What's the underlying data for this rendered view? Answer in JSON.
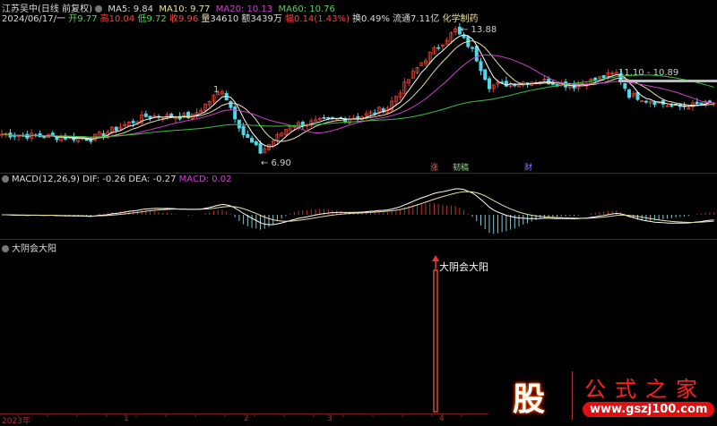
{
  "header": {
    "title": "江苏吴中(日线 前复权)",
    "ma5": "MA5: 9.84",
    "ma10": "MA10: 9.77",
    "ma20": "MA20: 10.13",
    "ma60": "MA60: 10.76",
    "date": "2024/06/17/一",
    "open_l": "开",
    "open": "9.77",
    "high_l": "高",
    "high": "10.04",
    "low_l": "低",
    "low": "9.72",
    "close_l": "收",
    "close": "9.96",
    "vol_l": "量",
    "vol": "34610",
    "amt_l": "额",
    "amt": "3439万",
    "chg_l": "幅",
    "chg": "0.14(1.43%)",
    "turn": "换0.49%",
    "float": "流通7.11亿",
    "industry": "化学制药"
  },
  "price_chart": {
    "high_label": "13.88",
    "low_label": "6.90",
    "range_label": "11.10 - 10.89",
    "marker_a": "1",
    "markers": [
      "涨",
      "韧稿",
      "财"
    ],
    "anchors": [
      [
        0,
        8.0
      ],
      [
        21,
        7.75
      ],
      [
        34,
        9.0
      ],
      [
        45,
        9.0
      ],
      [
        52,
        10.5
      ],
      [
        57,
        8.0
      ],
      [
        61,
        7.0
      ],
      [
        68,
        8.5
      ],
      [
        85,
        9.0
      ],
      [
        91,
        9.5
      ],
      [
        99,
        12.0
      ],
      [
        107,
        13.8
      ],
      [
        111,
        12.7
      ],
      [
        115,
        10.7
      ],
      [
        127,
        11.0
      ],
      [
        135,
        10.7
      ],
      [
        145,
        11.4
      ],
      [
        148,
        10.2
      ],
      [
        159,
        9.5
      ],
      [
        168,
        9.75
      ]
    ]
  },
  "macd": {
    "title": "MACD(12,26,9)",
    "dif": "DIF: -0.26",
    "dea": "DEA: -0.27",
    "macd": "MACD: 0.02"
  },
  "indicator": {
    "title": "大阴会大阳",
    "signal_label": "大阴会大阳"
  },
  "axis": {
    "labels": [
      "2023年",
      "1",
      "2",
      "3",
      "4"
    ]
  },
  "watermark": {
    "logo_char": "股",
    "name": "公式之家",
    "url": "www.gszj100.com"
  },
  "colors": {
    "up": "#e04030",
    "down": "#50d8e8",
    "ma5": "#ffffff",
    "ma10": "#e8e0a0",
    "ma20": "#d040d0",
    "ma60": "#40c040"
  }
}
